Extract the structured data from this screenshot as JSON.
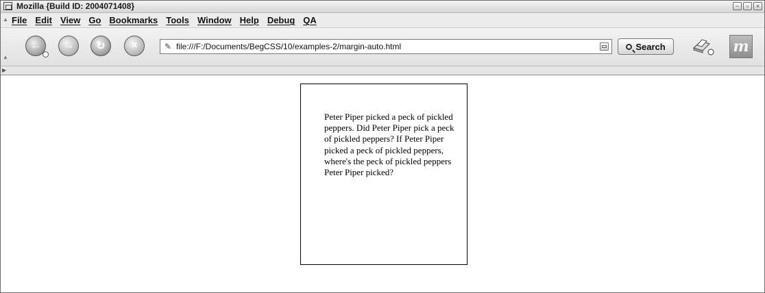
{
  "window": {
    "title": "Mozilla {Build ID: 2004071408}"
  },
  "window_buttons": [
    "−",
    "▫",
    "×"
  ],
  "menubar": {
    "items": [
      "File",
      "Edit",
      "View",
      "Go",
      "Bookmarks",
      "Tools",
      "Window",
      "Help",
      "Debug",
      "QA"
    ]
  },
  "navbar": {
    "url": "file:///F:/Documents/BegCSS/10/examples-2/margin-auto.html",
    "search_label": "Search",
    "throbber_letter": "m"
  },
  "page": {
    "paragraph": "Peter Piper picked a peck of pickled peppers. Did Peter Piper pick a peck of pickled peppers? If Peter Piper picked a peck of pickled peppers, where's the peck of pickled peppers Peter Piper picked?"
  }
}
